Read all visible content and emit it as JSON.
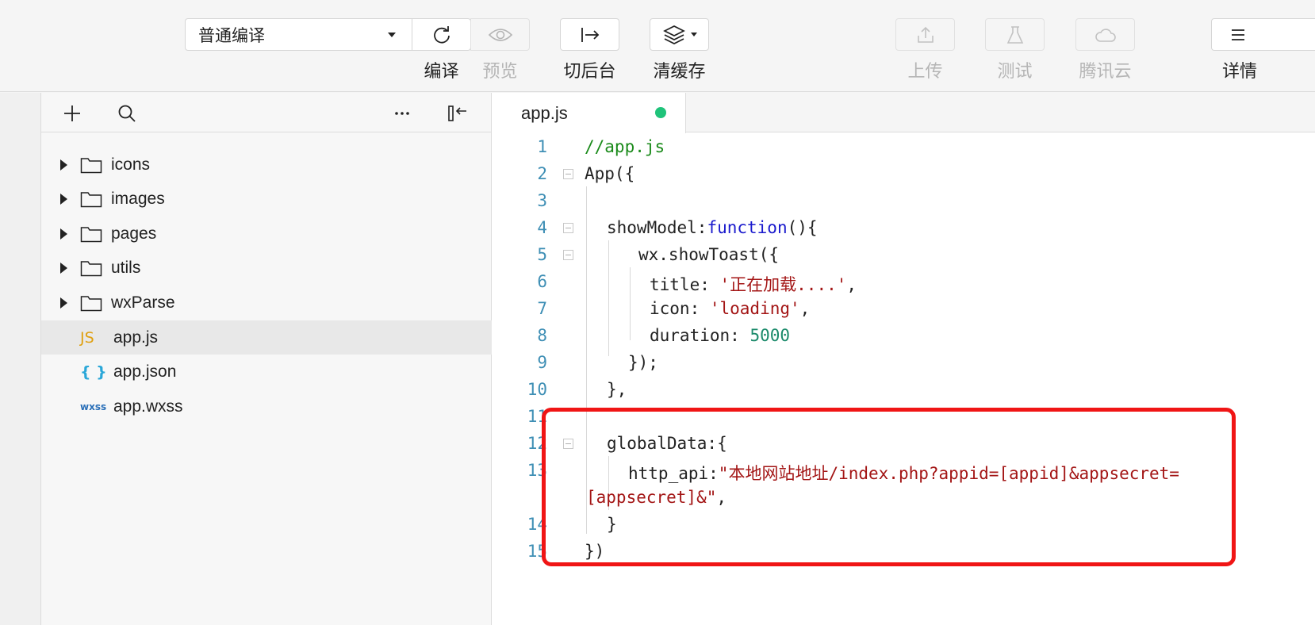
{
  "toolbar": {
    "mode_select": {
      "value": "普通编译"
    },
    "compile_label": "编译",
    "preview_label": "预览",
    "background_label": "切后台",
    "clear_cache_label": "清缓存",
    "upload_label": "上传",
    "test_label": "测试",
    "cloud_label": "腾讯云",
    "details_label": "详情"
  },
  "file_tree": {
    "folders": [
      {
        "label": "icons"
      },
      {
        "label": "images"
      },
      {
        "label": "pages"
      },
      {
        "label": "utils"
      },
      {
        "label": "wxParse"
      }
    ],
    "files": [
      {
        "type_icon": "JS",
        "label": "app.js",
        "selected": true
      },
      {
        "type_icon": "{ }",
        "label": "app.json",
        "selected": false
      },
      {
        "type_icon": "wxss",
        "label": "app.wxss",
        "selected": false
      }
    ]
  },
  "editor": {
    "tab_label": "app.js",
    "tab_status_color": "#1fc37a",
    "line_numbers": [
      "1",
      "2",
      "3",
      "4",
      "5",
      "6",
      "7",
      "8",
      "9",
      "10",
      "11",
      "12",
      "13",
      "14",
      "15"
    ],
    "code": {
      "l1": "//app.js",
      "l2": "App({",
      "l4_key": "showModel:",
      "l4_kw": "function",
      "l4_rest": "(){",
      "l5": "wx.showToast({",
      "l6_key": "title: ",
      "l6_str": "'正在加载....'",
      "l6_end": ",",
      "l7_key": "icon: ",
      "l7_str": "'loading'",
      "l7_end": ",",
      "l8_key": "duration: ",
      "l8_num": "5000",
      "l9": "});",
      "l10": "},",
      "l12": "globalData:{",
      "l13_key": "http_api:",
      "l13_str_a": "\"本地网站地址/index.php?appid=[appid]&appsecret=",
      "l13_str_b": "[appsecret]&\"",
      "l13_end": ",",
      "l14": "}",
      "l15": "})"
    }
  },
  "annotation": {
    "highlight_color": "#f01515"
  }
}
